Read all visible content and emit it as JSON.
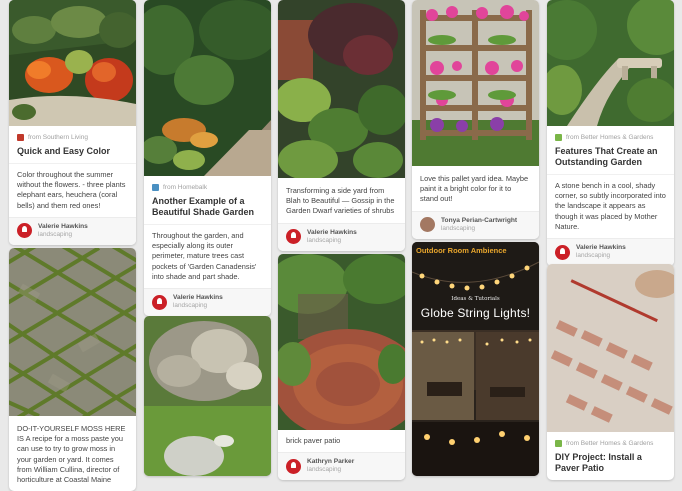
{
  "pins": [
    {
      "source": "from Southern Living",
      "title": "Quick and Easy Color",
      "description": "Color throughout the summer without the flowers. - three plants elephant ears, heuchera (coral bells) and them red ones!",
      "pinner": "Valerie Hawkins",
      "board": "landscaping"
    },
    {
      "source": "from Homebalk",
      "title": "Another Example of a Beautiful Shade Garden",
      "description": "Throughout the garden, and especially along its outer perimeter, mature trees cast pockets of 'Garden Canadensis' into shade and part shade.",
      "pinner": "Valerie Hawkins",
      "board": "landscaping"
    },
    {
      "description": "Transforming a side yard from Blah to Beautiful — Gossip in the Garden Dwarf varieties of shrubs",
      "pinner": "Valerie Hawkins",
      "board": "landscaping"
    },
    {
      "description": "Love this pallet yard idea. Maybe paint it a bright color for it to stand out!",
      "pinner": "Tonya Perian-Cartwright",
      "board": "landscaping"
    },
    {
      "source": "from Better Homes & Gardens",
      "title": "Features That Create an Outstanding Garden",
      "description": "A stone bench in a cool, shady corner, so subtly incorporated into the landscape it appears as though it was placed by Mother Nature.",
      "pinner": "Valerie Hawkins",
      "board": "landscaping"
    },
    {
      "description": "DO-IT-YOURSELF MOSS HERE IS A recipe for a moss paste you can use to try to grow moss in your garden or yard. It comes from William Cullina, director of horticulture at Coastal Maine"
    },
    {
      "description": "brick paver patio",
      "pinner": "Kathryn Parker",
      "board": "landscaping"
    },
    {
      "image_text": {
        "banner": "Outdoor Room Ambience",
        "small": "Ideas & Tutorials",
        "headline": "Globe String Lights!"
      }
    },
    {
      "source": "from Better Homes & Gardens",
      "title": "DIY Project: Install a Paver Patio"
    }
  ],
  "colors": {
    "page_bg": "#e9e9e9",
    "pin_red": "#cb2027",
    "card_bg": "#ffffff",
    "muted_text": "#a0a0a0"
  },
  "icons": {
    "pinner_avatar": "pin-icon",
    "source_icon": "site-favicon"
  }
}
